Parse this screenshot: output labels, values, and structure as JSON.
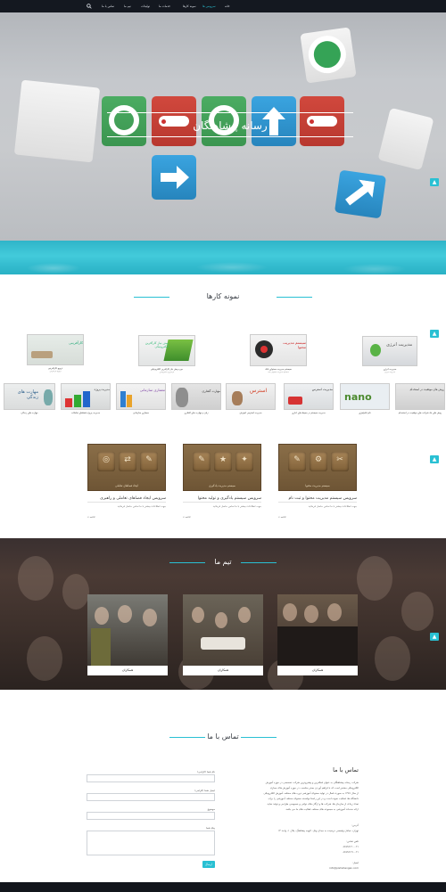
{
  "nav": {
    "items": [
      {
        "label": "خانه",
        "active": false
      },
      {
        "label": "سرویس ها",
        "active": true
      },
      {
        "label": "نمونه کارها",
        "active": false
      },
      {
        "label": "خدمات ما",
        "active": false
      },
      {
        "label": "تولیدات",
        "active": false
      },
      {
        "label": "تیم ما",
        "active": false
      },
      {
        "label": "تماس با ما",
        "active": false
      }
    ],
    "search_icon": "search-icon"
  },
  "hero": {
    "title": "رسانه پیشاهنگان"
  },
  "portfolio": {
    "title": "نمونه کارها",
    "row1": [
      {
        "caption": "مدیریت انرژی",
        "sub": "مدیریت انرژی",
        "label": "مدیریت انرژی"
      },
      {
        "caption": "سیستم مدیریت محتوای بانک",
        "sub": "سیستم مدیریت محتوای بانک",
        "label": "سیستم مدیریت محتوا"
      },
      {
        "caption": "دوره پیش نیاز کارآفرین الکترونیکی",
        "sub": "کارآفرین الکترونیکی",
        "label": "پیش نیاز کارآفرین الکترونیکی"
      },
      {
        "caption": "ترویج کارآفرینی",
        "sub": "ترویج کارآفرینی",
        "label": "کارآفرینی"
      }
    ],
    "row2": [
      {
        "caption": "روش های یک شرکت های موفقیت در استخدام",
        "sub": "روش های موفقیت در استخدام",
        "label": "روش های موفقیت در استخدام"
      },
      {
        "caption": "نانو تکنولوژی",
        "sub": "نانو تکنولوژی",
        "label": "nano"
      },
      {
        "caption": "مدیریت سیستم در محیط های اداری",
        "sub": "مدیریت استرس",
        "label": "مدیریت استرس"
      },
      {
        "caption": "مدیریت استرس آموزش",
        "sub": "مدیریت استرس",
        "label": "استرس"
      },
      {
        "caption": "زبان و مهارت های گفتاری",
        "sub": "زبان و مهارت",
        "label": "مهارت گفتاری"
      },
      {
        "caption": "معماری سازمانی",
        "sub": "معماری سازمانی",
        "label": "معماری سازمانی"
      },
      {
        "caption": "مدیریت پروژه فضاهای تعاملات",
        "sub": "مدیریت پروژه",
        "label": "مدیریت پروژه"
      },
      {
        "caption": "مهارت های زندگی",
        "sub": "مهارت های زندگی",
        "label": "مهارت های زندگی"
      }
    ]
  },
  "services": [
    {
      "title": "سرویس سیستم مدیریت محتوا و ثبت نام",
      "badge_label": "سیستم مدیریت محتوا",
      "desc": "جهت اطلاعات بیشتر با ما تماس حاصل فرمائید",
      "more": "ادامه »"
    },
    {
      "title": "سرویس سیستم یادگیری و تولید محتوا",
      "badge_label": "سیستم مدیریت یادگیری",
      "desc": "جهت اطلاعات بیشتر با ما تماس حاصل فرمائید",
      "more": "ادامه »"
    },
    {
      "title": "سرویس ایجاد فضاهای تعاملی و راهبری",
      "badge_label": "ایجاد فضاهای تعاملی",
      "desc": "جهت اطلاعات بیشتر با ما تماس حاصل فرمائید",
      "more": "ادامه »"
    }
  ],
  "team": {
    "title": "تیم ما",
    "members": [
      {
        "name": "همکاران"
      },
      {
        "name": "همکاران"
      },
      {
        "name": "همکاران"
      }
    ]
  },
  "contact": {
    "title": "تماس با ما",
    "heading": "تماس با ما",
    "about": [
      "شرکت رسانه پیشاهنگان به عنوان فعالترین و پیشروترین شرکت تخصصی در حوزه آموزش",
      "الکترونیکی مفتخر است که با فراهم آوردن بستر مناسب، در حوزه آموزش های مجازی",
      "از سال ۱۳۸۷ به صورت فعال در تولید محتوای آموزشی دوره های مختلف آموزش الکترونیکی",
      "دانشگاه ها، فعالیت نموده است و در این راستا توانسته محتوای مختلف آموزشی را برای",
      "تعداد زیادی از سازمان ها، شرکت ها و ارگان های دولتی و خصوصی طراحی و تولید نماید.",
      "ارائه خدمات آموزشی به مجموعه های مختلف فعالیت های ما می باشد."
    ],
    "address_label": "آدرس:",
    "address": "تهران- خیابان ولیعصر- نرسیده به میدان ونک- کوچه پیشاهنگ- پلاک ۱- واحد ۱۴",
    "phone_label": "تلفن تماس:",
    "phone1": "۸۸۷۹۶۱۲۰-۰۲۱",
    "phone2": "۸۸۷۹۶۱۲۱-۰۲۱",
    "email_label": "ایمیل:",
    "email": "info@pishahangan.com",
    "form": {
      "name_label": "نام شما (الزامی)",
      "email_label": "ایمیل شما (الزامی)",
      "subject_label": "موضوع",
      "message_label": "پیام شما",
      "send_label": "ارسال"
    }
  },
  "colors": {
    "accent": "#29c0d3",
    "nav_bg": "#141820",
    "footer_bg": "#13161c"
  }
}
